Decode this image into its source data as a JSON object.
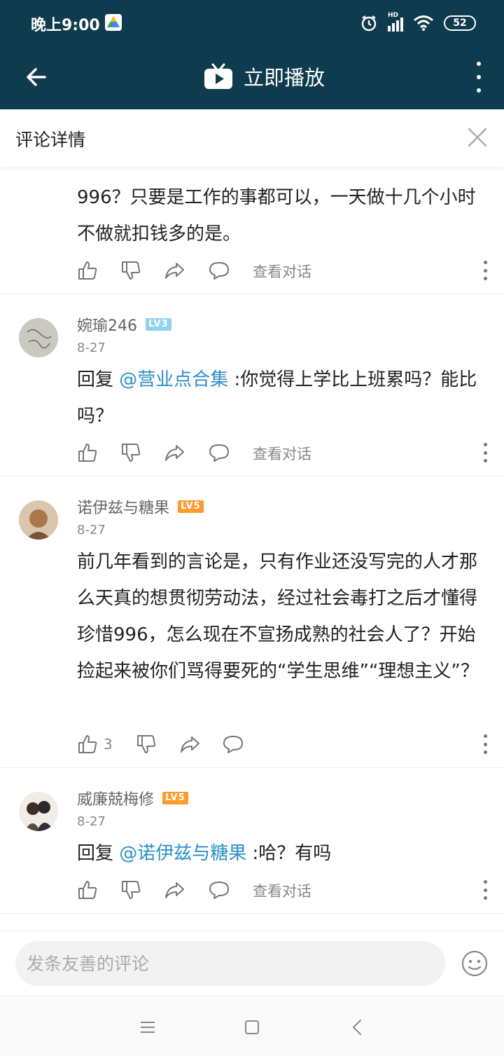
{
  "status_bar": {
    "time": "晚上9:00",
    "network": "HD",
    "battery": "52"
  },
  "app_bar": {
    "title": "立即播放"
  },
  "panel": {
    "title": "评论详情"
  },
  "comments": [
    {
      "partial": true,
      "text": "996？只要是工作的事都可以，一天做十几个小时不做就扣钱多的是。",
      "view_conversation": "查看对话"
    },
    {
      "username": "婉瑜246",
      "level": "LV3",
      "date": "8-27",
      "reply_prefix": "回复 ",
      "mention": "@营业点合集",
      "text": " :你觉得上学比上班累吗？能比吗？",
      "view_conversation": "查看对话"
    },
    {
      "username": "诺伊兹与糖果",
      "level": "LV5",
      "date": "8-27",
      "text": "前几年看到的言论是，只有作业还没写完的人才那么天真的想贯彻劳动法，经过社会毒打之后才懂得珍惜996，怎么现在不宣扬成熟的社会人了？开始捡起来被你们骂得要死的“学生思维”“理想主义”？",
      "like_count": "3"
    },
    {
      "username": "威廉兢梅修",
      "level": "LV5",
      "date": "8-27",
      "reply_prefix": "回复 ",
      "mention": "@诺伊兹与糖果",
      "text": " :哈？有吗",
      "view_conversation": "查看对话"
    }
  ],
  "input": {
    "placeholder": "发条友善的评论"
  },
  "colors": {
    "header_bg": "#0e3b4d",
    "mention": "#2b8fc8",
    "lv3": "#8fd3ee",
    "lv5": "#ff9a2e"
  }
}
